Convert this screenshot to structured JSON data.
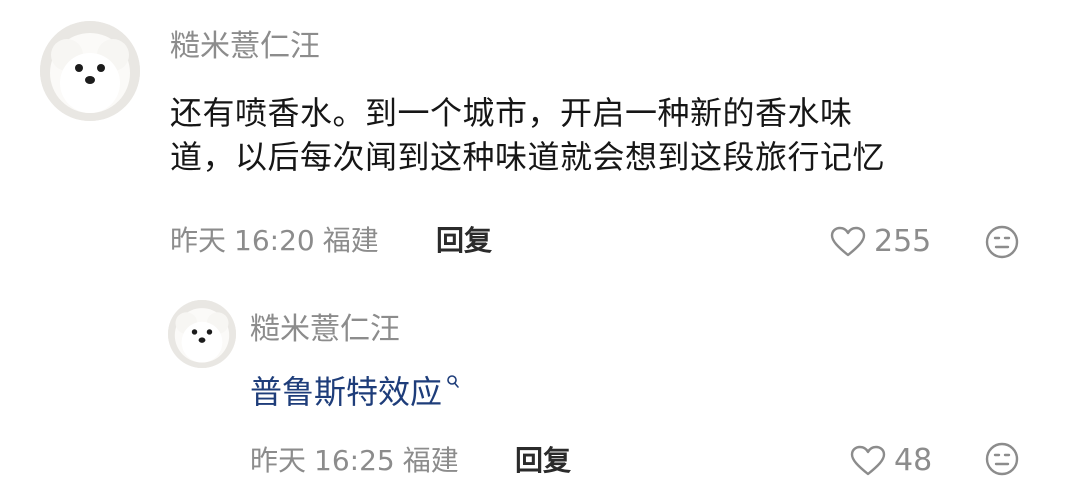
{
  "comment": {
    "username": "糙米薏仁汪",
    "text_line1": "还有喷香水。到一个城市，开启一种新的香水味",
    "text_line2": "道，以后每次闻到这种味道就会想到这段旅行记忆",
    "date": "昨天",
    "time": "16:20",
    "location": "福建",
    "reply_label": "回复",
    "like_count": "255",
    "avatar_icon": "pomeranian-dog-avatar",
    "like_icon": "heart-outline-icon",
    "dislike_icon": "frown-face-icon"
  },
  "reply": {
    "username": "糙米薏仁汪",
    "text": "普鲁斯特效应",
    "search_icon": "search-icon",
    "date": "昨天",
    "time": "16:25",
    "location": "福建",
    "reply_label": "回复",
    "like_count": "48",
    "avatar_icon": "pomeranian-dog-avatar",
    "like_icon": "heart-outline-icon",
    "dislike_icon": "frown-face-icon"
  },
  "colors": {
    "username": "#8c8c8c",
    "body_text": "#161616",
    "link_text": "#1e3d7a",
    "meta_text": "#8c8c8c",
    "reply_label": "#2b2b2b"
  }
}
